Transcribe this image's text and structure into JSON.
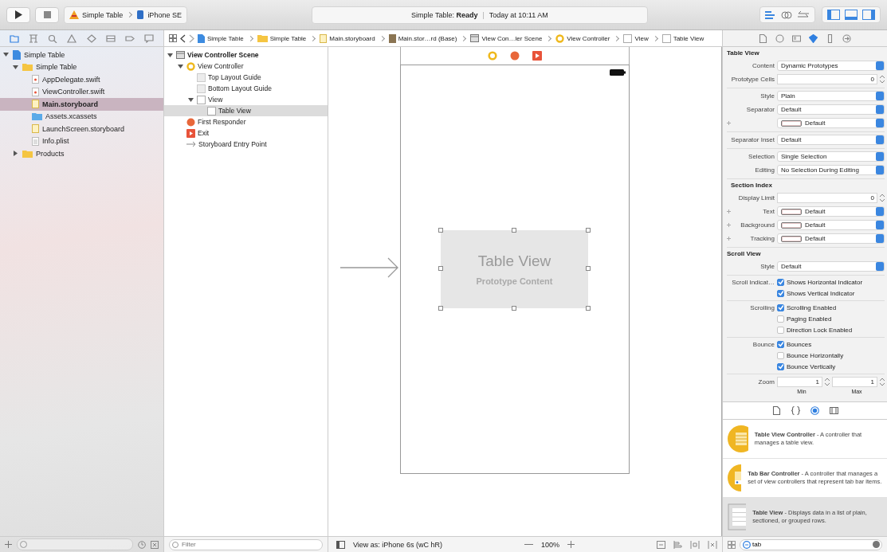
{
  "toolbar": {
    "scheme": "Simple Table",
    "device": "iPhone SE",
    "status_project": "Simple Table:",
    "status_state": "Ready",
    "status_separator": "|",
    "status_time": "Today at 10:11 AM"
  },
  "navigator": {
    "tabs": [
      {
        "kind": "folder",
        "selected": true
      },
      {
        "kind": "symbol",
        "selected": false
      },
      {
        "kind": "search",
        "selected": false
      },
      {
        "kind": "issue",
        "selected": false
      },
      {
        "kind": "test",
        "selected": false
      },
      {
        "kind": "debug",
        "selected": false
      },
      {
        "kind": "breakpoint",
        "selected": false
      },
      {
        "kind": "report",
        "selected": false
      }
    ],
    "tree": [
      {
        "label": "Simple Table",
        "kind": "project",
        "expanded": true,
        "selected": false,
        "children": [
          {
            "label": "Simple Table",
            "kind": "folder",
            "expanded": true,
            "selected": false,
            "children": [
              {
                "label": "AppDelegate.swift",
                "kind": "swift",
                "selected": false
              },
              {
                "label": "ViewController.swift",
                "kind": "swift",
                "selected": false
              },
              {
                "label": "Main.storyboard",
                "kind": "storyboard",
                "selected": true
              },
              {
                "label": "Assets.xcassets",
                "kind": "assets",
                "selected": false
              },
              {
                "label": "LaunchScreen.storyboard",
                "kind": "storyboard",
                "selected": false
              },
              {
                "label": "Info.plist",
                "kind": "plist",
                "selected": false
              }
            ]
          },
          {
            "label": "Products",
            "kind": "folder",
            "expanded": false,
            "selected": false
          }
        ]
      }
    ]
  },
  "breadcrumbs": [
    {
      "label": "Simple Table",
      "kind": "project"
    },
    {
      "label": "Simple Table",
      "kind": "folder"
    },
    {
      "label": "Main.storyboard",
      "kind": "storyboard"
    },
    {
      "label": "Main.stor…rd (Base)",
      "kind": "doc"
    },
    {
      "label": "View Con…ler Scene",
      "kind": "scene"
    },
    {
      "label": "View Controller",
      "kind": "controller"
    },
    {
      "label": "View",
      "kind": "view"
    },
    {
      "label": "Table View",
      "kind": "view"
    }
  ],
  "outline": {
    "filter_placeholder": "Filter",
    "tree": [
      {
        "label": "View Controller Scene",
        "kind": "scene",
        "expanded": true,
        "selected": false,
        "children": [
          {
            "label": "View Controller",
            "kind": "controller",
            "expanded": true,
            "selected": false,
            "children": [
              {
                "label": "Top Layout Guide",
                "kind": "guide",
                "selected": false
              },
              {
                "label": "Bottom Layout Guide",
                "kind": "guide",
                "selected": false
              },
              {
                "label": "View",
                "kind": "view",
                "expanded": true,
                "selected": false,
                "children": [
                  {
                    "label": "Table View",
                    "kind": "view",
                    "selected": true
                  }
                ]
              }
            ]
          },
          {
            "label": "First Responder",
            "kind": "responder",
            "selected": false
          },
          {
            "label": "Exit",
            "kind": "exit",
            "selected": false
          },
          {
            "label": "Storyboard Entry Point",
            "kind": "entry",
            "selected": false
          }
        ]
      }
    ]
  },
  "canvas": {
    "table_title": "Table View",
    "table_subtitle": "Prototype Content"
  },
  "editor_bar": {
    "view_as": "View as: iPhone 6s (wC hR)",
    "zoom": "100%"
  },
  "inspector": {
    "tabs": [
      {
        "kind": "file",
        "selected": false
      },
      {
        "kind": "help",
        "selected": false
      },
      {
        "kind": "identity",
        "selected": false
      },
      {
        "kind": "attributes",
        "selected": true
      },
      {
        "kind": "size",
        "selected": false
      },
      {
        "kind": "connections",
        "selected": false
      }
    ],
    "sections": [
      {
        "title": "Table View",
        "groups": [
          [
            {
              "kind": "popup",
              "label": "Content",
              "value": "Dynamic Prototypes"
            },
            {
              "kind": "stepper",
              "label": "Prototype Cells",
              "value": "0"
            }
          ],
          [
            {
              "kind": "popup",
              "label": "Style",
              "value": "Plain"
            },
            {
              "kind": "popup",
              "label": "Separator",
              "value": "Default"
            },
            {
              "kind": "color",
              "value": "Default"
            }
          ],
          [
            {
              "kind": "popup",
              "label": "Separator Inset",
              "value": "Default"
            }
          ],
          [
            {
              "kind": "popup",
              "label": "Selection",
              "value": "Single Selection"
            },
            {
              "kind": "popup",
              "label": "Editing",
              "value": "No Selection During Editing"
            }
          ]
        ]
      },
      {
        "title": "Section Index",
        "groups": [
          [
            {
              "kind": "stepper",
              "label": "Display Limit",
              "value": "0"
            },
            {
              "kind": "color",
              "label": "Text",
              "value": "Default"
            },
            {
              "kind": "color",
              "label": "Background",
              "value": "Default"
            },
            {
              "kind": "color",
              "label": "Tracking",
              "value": "Default"
            }
          ]
        ]
      },
      {
        "title": "Scroll View",
        "groups": [
          [
            {
              "kind": "popup",
              "label": "Style",
              "value": "Default"
            }
          ],
          [
            {
              "kind": "checkbox",
              "label": "Scroll Indicat…",
              "text": "Shows Horizontal Indicator",
              "checked": true
            },
            {
              "kind": "checkbox",
              "text": "Shows Vertical Indicator",
              "checked": true
            }
          ],
          [
            {
              "kind": "checkbox",
              "label": "Scrolling",
              "text": "Scrolling Enabled",
              "checked": true
            },
            {
              "kind": "checkbox",
              "text": "Paging Enabled",
              "checked": false
            },
            {
              "kind": "checkbox",
              "text": "Direction Lock Enabled",
              "checked": false
            }
          ],
          [
            {
              "kind": "checkbox",
              "label": "Bounce",
              "text": "Bounces",
              "checked": true
            },
            {
              "kind": "checkbox",
              "text": "Bounce Horizontally",
              "checked": false
            },
            {
              "kind": "checkbox",
              "text": "Bounce Vertically",
              "checked": true
            }
          ],
          [
            {
              "kind": "zoom",
              "label": "Zoom",
              "min": "1",
              "max": "1",
              "min_label": "Min",
              "max_label": "Max"
            }
          ]
        ]
      }
    ],
    "library_tabs": [
      {
        "kind": "file",
        "selected": false
      },
      {
        "kind": "code",
        "selected": false
      },
      {
        "kind": "object",
        "selected": true
      },
      {
        "kind": "media",
        "selected": false
      }
    ],
    "library": [
      {
        "kind": "table-controller",
        "text": "**Table View Controller** - A controller that manages a table view.",
        "selected": false
      },
      {
        "kind": "tab-controller",
        "text": "**Tab Bar Controller** - A controller that manages a set of view controllers that represent tab bar items.",
        "selected": false
      },
      {
        "kind": "table-view",
        "text": "**Table View** - Displays data in a list of plain, sectioned, or grouped rows.",
        "selected": true
      }
    ],
    "search_value": "tab"
  }
}
